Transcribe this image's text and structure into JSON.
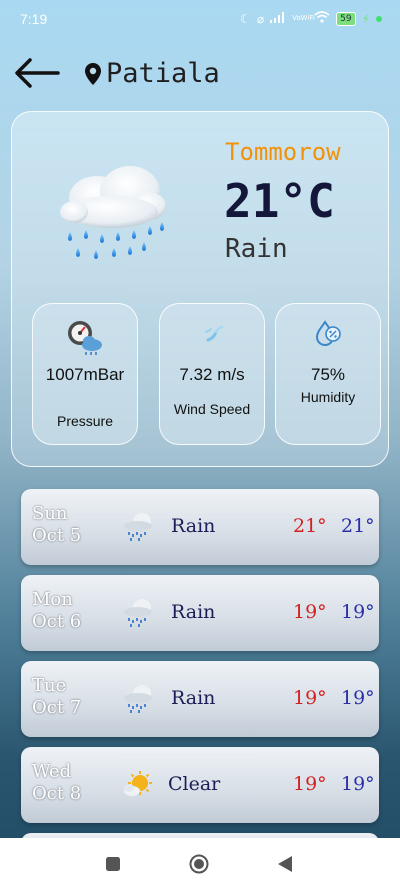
{
  "status_bar": {
    "time": "7:19",
    "network": "VoWiFi",
    "battery": "59"
  },
  "header": {
    "back_icon": "arrow-left-icon",
    "location_icon": "map-pin-icon",
    "location": "Patiala"
  },
  "today": {
    "day_label": "Tommorow",
    "temperature": "21°C",
    "condition": "Rain",
    "icon": "rain-cloud-icon",
    "stats": [
      {
        "icon": "gauge-icon",
        "value": "1007mBar",
        "label": "Pressure"
      },
      {
        "icon": "wind-icon",
        "value": "7.32 m/s",
        "label": "Wind Speed"
      },
      {
        "icon": "humidity-icon",
        "value": "75%",
        "label": "Humidity"
      }
    ]
  },
  "forecast": [
    {
      "day": "Sun",
      "date": "Oct 5",
      "condition": "Rain",
      "icon": "rain-cloud-icon",
      "high": "21°",
      "low": "21°"
    },
    {
      "day": "Mon",
      "date": "Oct 6",
      "condition": "Rain",
      "icon": "rain-cloud-icon",
      "high": "19°",
      "low": "19°"
    },
    {
      "day": "Tue",
      "date": "Oct 7",
      "condition": "Rain",
      "icon": "rain-cloud-icon",
      "high": "19°",
      "low": "19°"
    },
    {
      "day": "Wed",
      "date": "Oct 8",
      "condition": "Clear",
      "icon": "sun-cloud-icon",
      "high": "19°",
      "low": "19°"
    }
  ],
  "colors": {
    "day_label": "#f2920a",
    "temperature": "#15173a",
    "high_temp": "#d42020",
    "low_temp": "#2a2fa8"
  }
}
